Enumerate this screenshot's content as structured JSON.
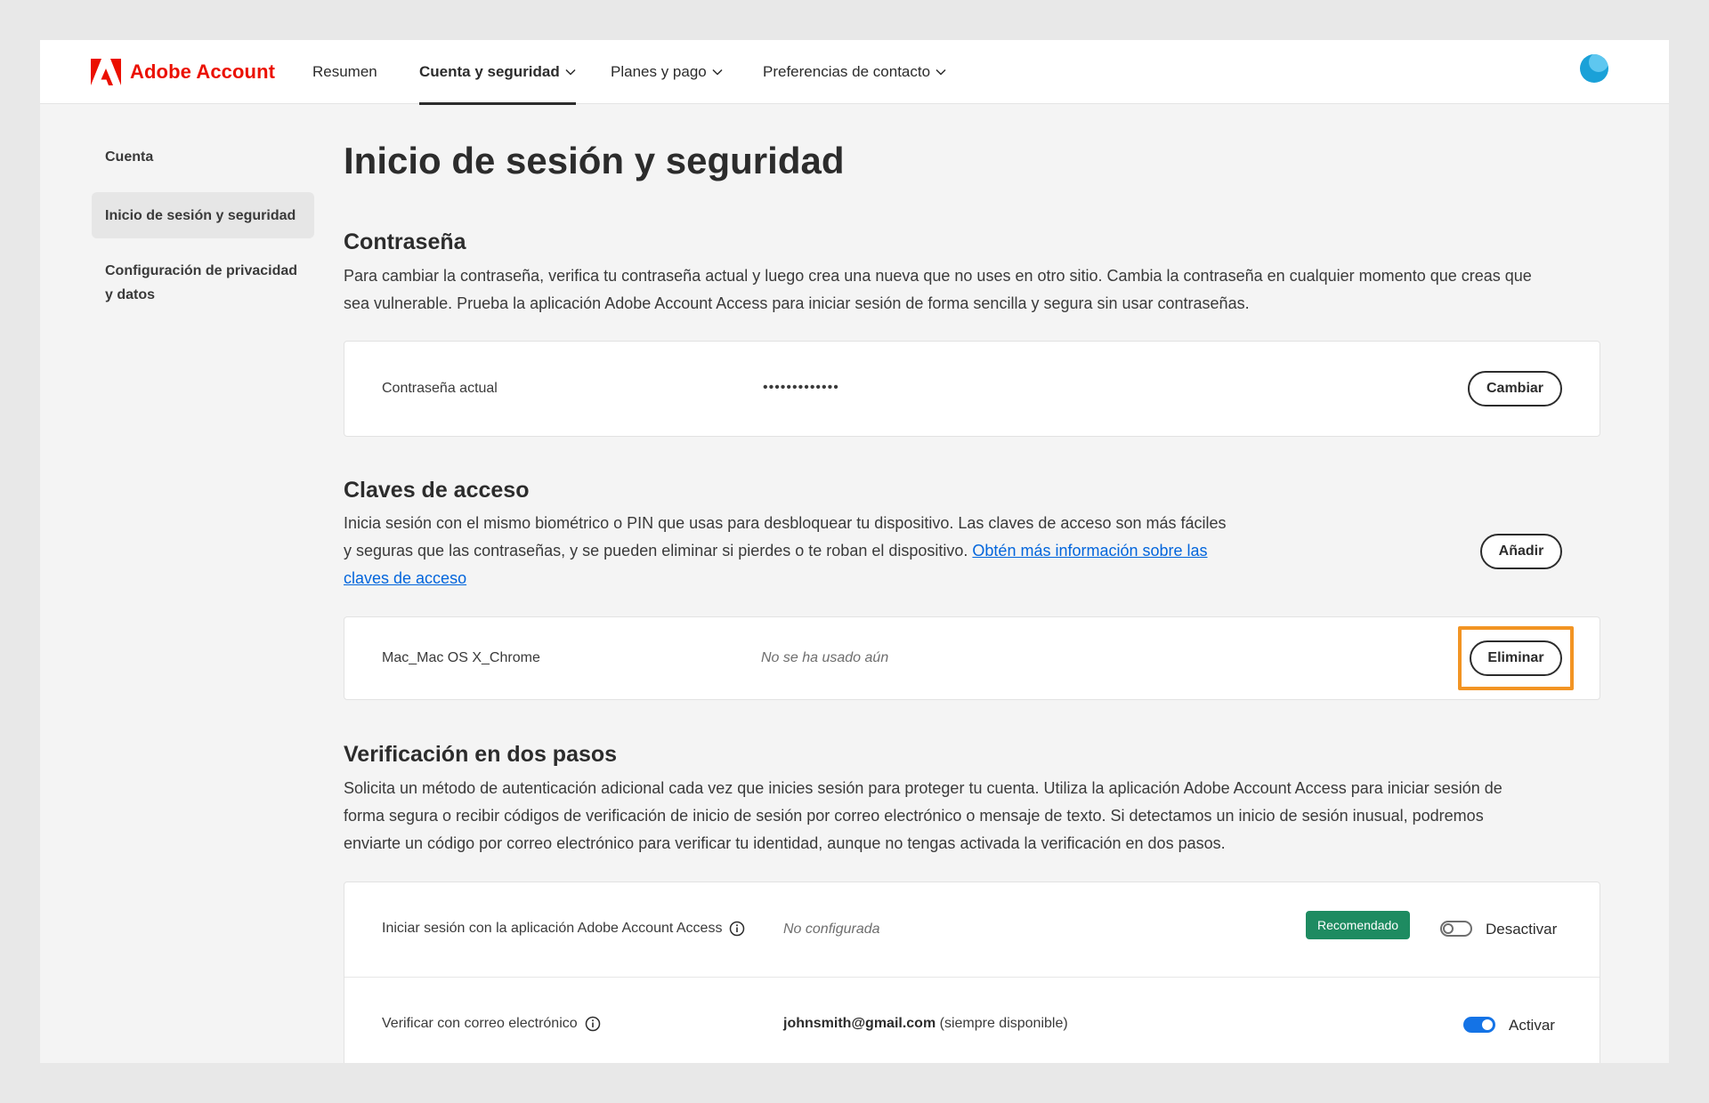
{
  "header": {
    "brand": "Adobe Account",
    "nav": [
      {
        "label": "Resumen"
      },
      {
        "label": "Cuenta y seguridad"
      },
      {
        "label": "Planes y pago"
      },
      {
        "label": "Preferencias de contacto"
      }
    ]
  },
  "sidebar": {
    "items": [
      {
        "label": "Cuenta"
      },
      {
        "label": "Inicio de sesión y seguridad"
      },
      {
        "label_line1": "Configuración de privacidad",
        "label_line2": "y datos"
      }
    ]
  },
  "page": {
    "title": "Inicio de sesión y seguridad",
    "password": {
      "heading": "Contraseña",
      "desc_line1": "Para cambiar la contraseña, verifica tu contraseña actual y luego crea una nueva que no uses en otro sitio. Cambia la contraseña en cualquier momento que creas que",
      "desc_line2": "sea vulnerable. Prueba la aplicación Adobe Account Access para iniciar sesión de forma sencilla y segura sin usar contraseñas.",
      "row_label": "Contraseña actual",
      "row_value": "•••••••••••••",
      "button": "Cambiar"
    },
    "passkeys": {
      "heading": "Claves de acceso",
      "desc_line1": "Inicia sesión con el mismo biométrico o PIN que usas para desbloquear tu dispositivo. Las claves de acceso son más fáciles",
      "desc_line2": "y seguras que las contraseñas, y se pueden eliminar si pierdes o te roban el dispositivo.",
      "link_part1": "Obtén más información sobre las",
      "link_part2": "claves de acceso",
      "add_button": "Añadir",
      "device_name": "Mac_Mac OS X_Chrome",
      "device_status": "No se ha usado aún",
      "remove_button": "Eliminar"
    },
    "two_step": {
      "heading": "Verificación en dos pasos",
      "desc_line1": "Solicita un método de autenticación adicional cada vez que inicies sesión para proteger tu cuenta. Utiliza la aplicación Adobe Account Access para iniciar sesión de",
      "desc_line2": "forma segura o recibir códigos de verificación de inicio de sesión por correo electrónico o mensaje de texto. Si detectamos un inicio de sesión inusual, podremos",
      "desc_line3": "enviarte un código por correo electrónico para verificar tu identidad, aunque no tengas activada la verificación en dos pasos.",
      "app_row": {
        "label": "Iniciar sesión con la aplicación Adobe Account Access",
        "status": "No configurada",
        "badge": "Recomendado",
        "toggle_label": "Desactivar",
        "toggle_on": false
      },
      "email_row": {
        "label": "Verificar con correo electrónico",
        "email": "johnsmith@gmail.com",
        "note": "(siempre disponible)",
        "toggle_label": "Activar",
        "toggle_on": true
      }
    }
  },
  "colors": {
    "brand_red": "#eb1000",
    "highlight_orange": "#f29423",
    "badge_green": "#1e8b61",
    "toggle_blue": "#1473e6",
    "link_blue": "#0265dc"
  }
}
